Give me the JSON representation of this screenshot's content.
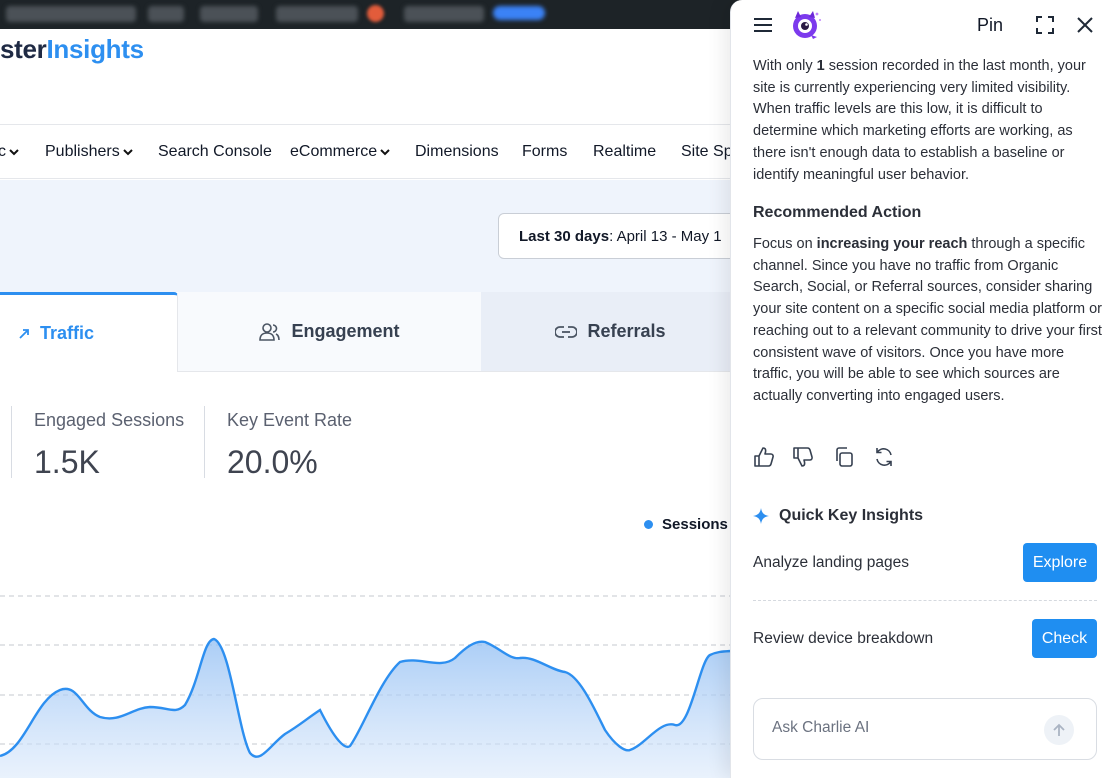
{
  "logo": {
    "part1": "ster",
    "part2": "Insights"
  },
  "nav": {
    "items": [
      {
        "label": "c"
      },
      {
        "label": "Publishers"
      },
      {
        "label": "Search Console"
      },
      {
        "label": "eCommerce"
      },
      {
        "label": "Dimensions"
      },
      {
        "label": "Forms"
      },
      {
        "label": "Realtime"
      },
      {
        "label": "Site Spe"
      }
    ]
  },
  "date_range": {
    "label": "Last 30 days",
    "value": ": April 13 - May 1"
  },
  "tabs": {
    "traffic": "Traffic",
    "engagement": "Engagement",
    "referrals": "Referrals"
  },
  "metrics": [
    {
      "label": "Engaged Sessions",
      "value": "1.5K"
    },
    {
      "label": "Key Event Rate",
      "value": "20.0%"
    }
  ],
  "chart": {
    "legend": "Sessions",
    "color": "#2d8ff0"
  },
  "panel": {
    "pin_label": "Pin",
    "msg": {
      "p1": "With only ",
      "bold1": "1",
      "p2": " session recorded in the last month, your site is currently experiencing very limited visibility. When traffic levels are this low, it is difficult to determine which marketing efforts are working, as there isn't enough data to establish a baseline or identify meaningful user behavior."
    },
    "recommended_title": "Recommended Action",
    "rec": {
      "p1": "Focus on ",
      "bold1": "increasing your reach",
      "p2": " through a specific channel. Since you have no traffic from Organic Search, Social, or Referral sources, consider sharing your site content on a specific social media platform or reaching out to a relevant community to drive your first consistent wave of visitors. Once you have more traffic, you will be able to see which sources are actually converting into engaged users."
    },
    "quick_insights_title": "Quick Key Insights",
    "insights": [
      {
        "label": "Analyze landing pages",
        "button": "Explore"
      },
      {
        "label": "Review device breakdown",
        "button": "Check"
      }
    ],
    "ask_placeholder": "Ask Charlie AI"
  }
}
